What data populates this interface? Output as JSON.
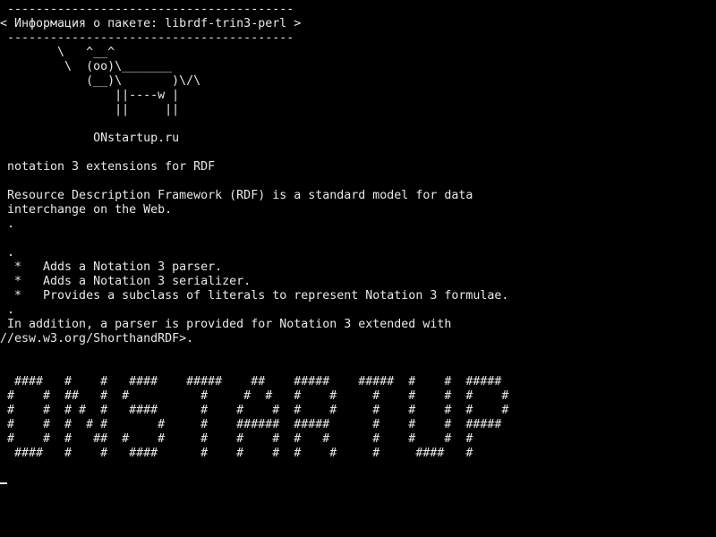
{
  "terminal": {
    "lines": [
      " ---------------------------------------- ",
      "< Информация о пакете: librdf-trin3-perl >",
      " ---------------------------------------- ",
      "        \\   ^__^",
      "         \\  (oo)\\_______",
      "            (__)\\       )\\/\\",
      "                ||----w |",
      "                ||     ||",
      "",
      "             ONstartup.ru",
      "",
      " notation 3 extensions for RDF",
      "",
      " Resource Description Framework (RDF) is a standard model for data",
      " interchange on the Web.",
      " .",
      "",
      " .",
      "  *   Adds a Notation 3 parser.",
      "  *   Adds a Notation 3 serializer.",
      "  *   Provides a subclass of literals to represent Notation 3 formulae.",
      " .",
      " In addition, a parser is provided for Notation 3 extended with",
      "//esw.w3.org/ShorthandRDF>.",
      "",
      "",
      "  ####   #    #   ####    #####    ##    #####    #####  #    #  #####",
      " #    #  ##   #  #          #     #  #   #    #     #    #    #  #    #",
      " #    #  # #  #   ####      #    #    #  #    #     #    #    #  #    #",
      " #    #  #  # #       #     #    ######  #####      #    #    #  #####",
      " #    #  #   ##  #    #     #    #    #  #   #      #    #    #  #",
      "  ####   #    #   ####      #    #    #  #    #     #     ####   #"
    ]
  }
}
